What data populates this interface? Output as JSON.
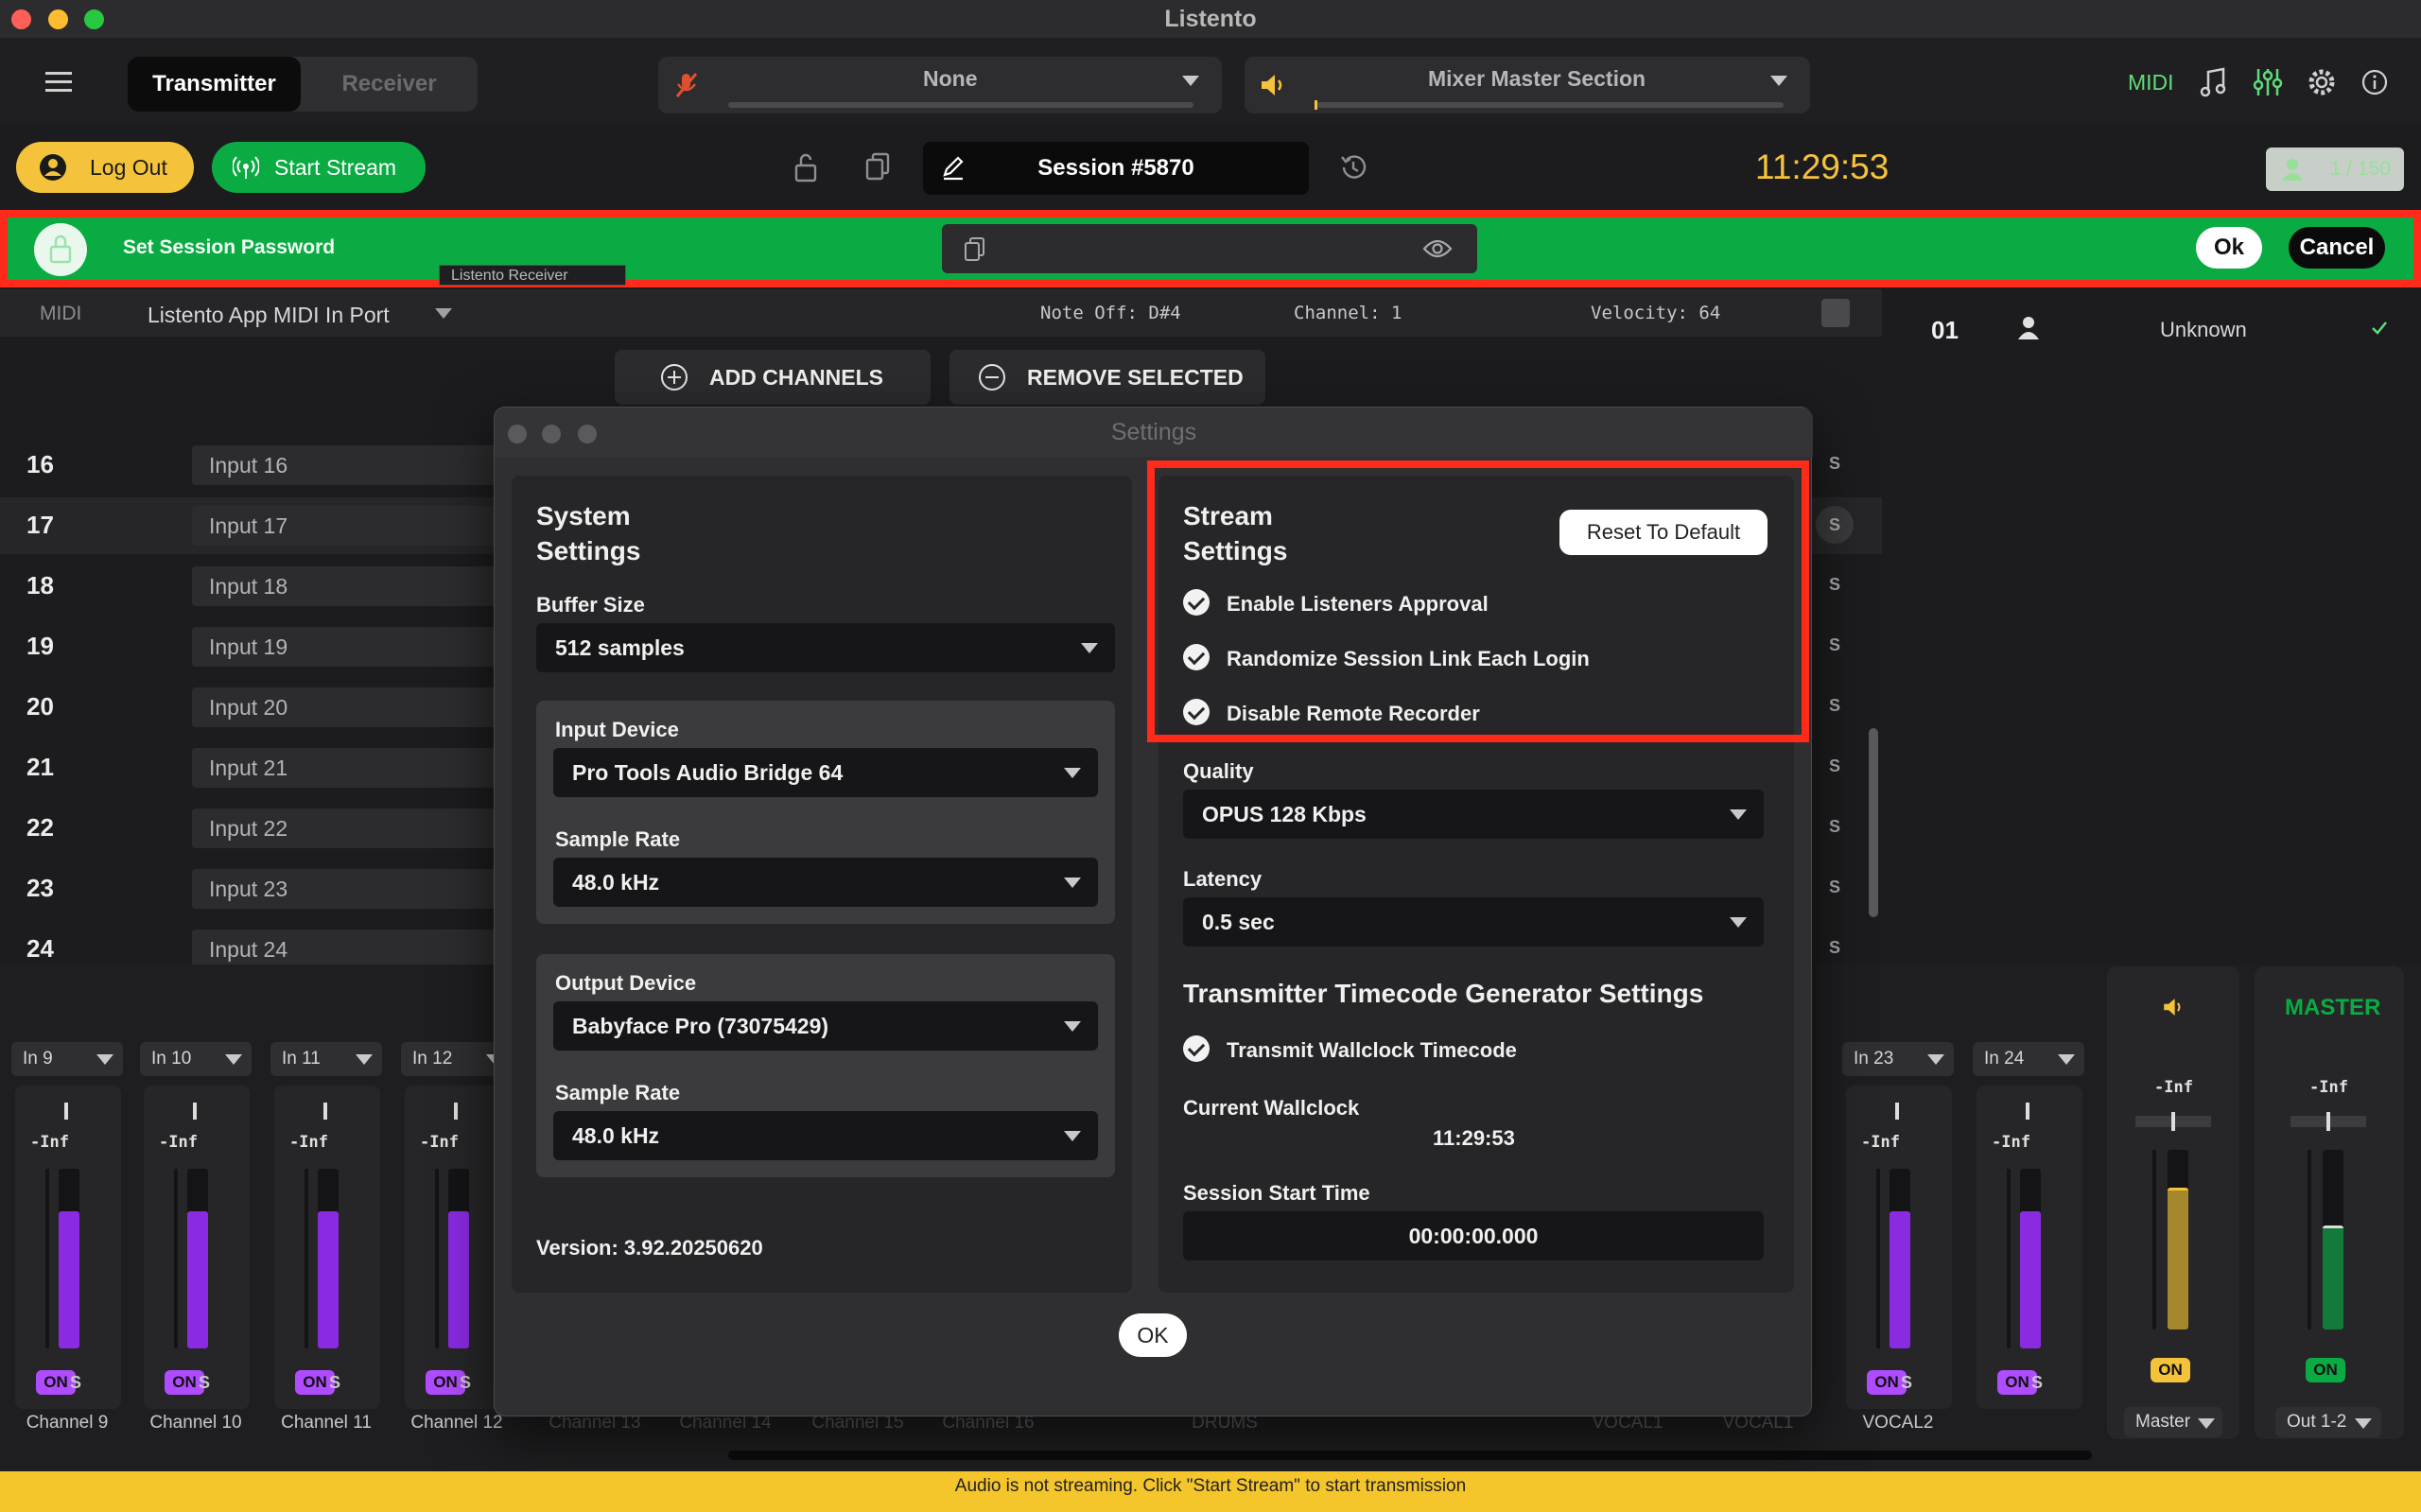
{
  "app": {
    "title": "Listento"
  },
  "toolbar": {
    "transmitter_tab": "Transmitter",
    "receiver_tab": "Receiver",
    "input_select": "None",
    "output_select": "Mixer Master Section",
    "midi_label": "MIDI"
  },
  "actions": {
    "logout": "Log Out",
    "start_stream": "Start Stream",
    "session": "Session #5870",
    "clock": "11:29:53",
    "listeners": "1 / 150"
  },
  "password_bar": {
    "label": "Set Session Password",
    "ok": "Ok",
    "cancel": "Cancel",
    "tooltip": "Listento Receiver"
  },
  "midi_row": {
    "label": "MIDI",
    "port": "Listento App MIDI In Port",
    "note": "Note Off: D#4",
    "channel": "Channel:  1",
    "velocity": "Velocity:  64"
  },
  "channel_actions": {
    "add": "ADD CHANNELS",
    "remove": "REMOVE SELECTED"
  },
  "listener_list": [
    {
      "num": "01",
      "name": "Unknown"
    }
  ],
  "channels": [
    {
      "num": "16",
      "name": "Input 16"
    },
    {
      "num": "17",
      "name": "Input 17"
    },
    {
      "num": "18",
      "name": "Input 18"
    },
    {
      "num": "19",
      "name": "Input 19"
    },
    {
      "num": "20",
      "name": "Input 20"
    },
    {
      "num": "21",
      "name": "Input 21"
    },
    {
      "num": "22",
      "name": "Input 22"
    },
    {
      "num": "23",
      "name": "Input 23"
    },
    {
      "num": "24",
      "name": "Input 24"
    }
  ],
  "solo_label": "S",
  "mixer": {
    "strips": [
      {
        "input": "In 9",
        "level": "-Inf",
        "on": "ON",
        "solo": "S",
        "name": "Channel 9"
      },
      {
        "input": "In 10",
        "level": "-Inf",
        "on": "ON",
        "solo": "S",
        "name": "Channel 10"
      },
      {
        "input": "In 11",
        "level": "-Inf",
        "on": "ON",
        "solo": "S",
        "name": "Channel 11"
      },
      {
        "input": "In 12",
        "level": "-Inf",
        "on": "ON",
        "solo": "S",
        "name": "Channel 12"
      },
      {
        "input": "In 23",
        "level": "-Inf",
        "on": "ON",
        "solo": "S",
        "name": "VOCAL2"
      },
      {
        "input": "In 24",
        "level": "-Inf",
        "on": "ON",
        "solo": "S",
        "name": ""
      }
    ],
    "hidden_labels": [
      "Channel 13",
      "Channel 14",
      "Channel 15",
      "Channel 16",
      "DRUMS",
      "VOCAL1",
      "VOCAL1"
    ],
    "master_bus": {
      "level": "-Inf",
      "on": "ON",
      "select": "Master"
    },
    "master": {
      "title": "MASTER",
      "level": "-Inf",
      "on": "ON",
      "select": "Out 1-2"
    }
  },
  "settings": {
    "title": "Settings",
    "system": {
      "heading_1": "System",
      "heading_2": "Settings",
      "buffer_label": "Buffer Size",
      "buffer_value": "512 samples",
      "input_device_label": "Input Device",
      "input_device_value": "Pro Tools Audio Bridge 64",
      "input_rate_label": "Sample Rate",
      "input_rate_value": "48.0 kHz",
      "output_device_label": "Output Device",
      "output_device_value": "Babyface Pro (73075429)",
      "output_rate_label": "Sample Rate",
      "output_rate_value": "48.0 kHz",
      "version": "Version: 3.92.20250620"
    },
    "stream": {
      "heading_1": "Stream",
      "heading_2": "Settings",
      "reset": "Reset To Default",
      "opt_approval": "Enable Listeners Approval",
      "opt_randomize": "Randomize Session Link Each Login",
      "opt_recorder": "Disable Remote Recorder",
      "quality_label": "Quality",
      "quality_value": "OPUS 128 Kbps",
      "latency_label": "Latency",
      "latency_value": "0.5 sec",
      "timecode_heading": "Transmitter Timecode Generator Settings",
      "opt_wallclock": "Transmit Wallclock Timecode",
      "wallclock_label": "Current Wallclock",
      "wallclock_value": "11:29:53",
      "start_label": "Session Start Time",
      "start_value": "00:00:00.000"
    },
    "ok": "OK"
  },
  "status": "Audio is not streaming. Click \"Start Stream\" to start transmission",
  "colors": {
    "accent_green": "#0bab44",
    "highlight_red": "#ff2a1a",
    "clock_yellow": "#f5c33b",
    "meter_purple": "#8a2be2",
    "status_yellow": "#f5c52c"
  }
}
